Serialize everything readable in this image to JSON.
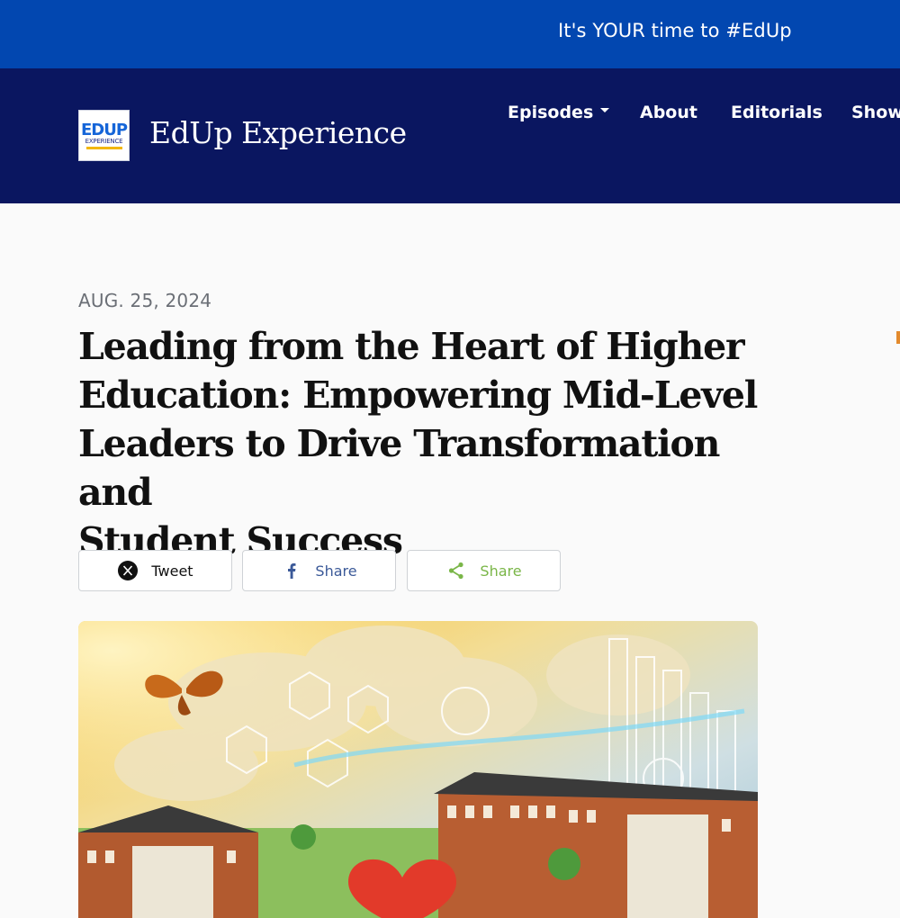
{
  "promo": {
    "text": "It's YOUR time to #EdUp"
  },
  "header": {
    "brand": "EdUp Experience",
    "logo": {
      "line1a": "ED",
      "line1b": "UP",
      "line2": "EXPERIENCE"
    },
    "nav": [
      {
        "label": "Episodes",
        "has_dropdown": true
      },
      {
        "label": "About"
      },
      {
        "label": "Editorials"
      },
      {
        "label": "Show"
      }
    ]
  },
  "article": {
    "date": "AUG. 25, 2024",
    "title_lines": [
      "Leading from the Heart of Higher",
      "Education: Empowering Mid-Level",
      "Leaders to Drive Transformation and",
      "Student Success"
    ],
    "share": [
      {
        "label": "Tweet",
        "icon": "x-icon",
        "color": "#111111"
      },
      {
        "label": "Share",
        "icon": "facebook-icon",
        "color": "#3b5998"
      },
      {
        "label": "Share",
        "icon": "share-icon",
        "color": "#7ab648"
      }
    ]
  },
  "colors": {
    "promo_bg": "#0247b0",
    "nav_bg": "#0a1660",
    "page_bg": "#fafafa"
  }
}
